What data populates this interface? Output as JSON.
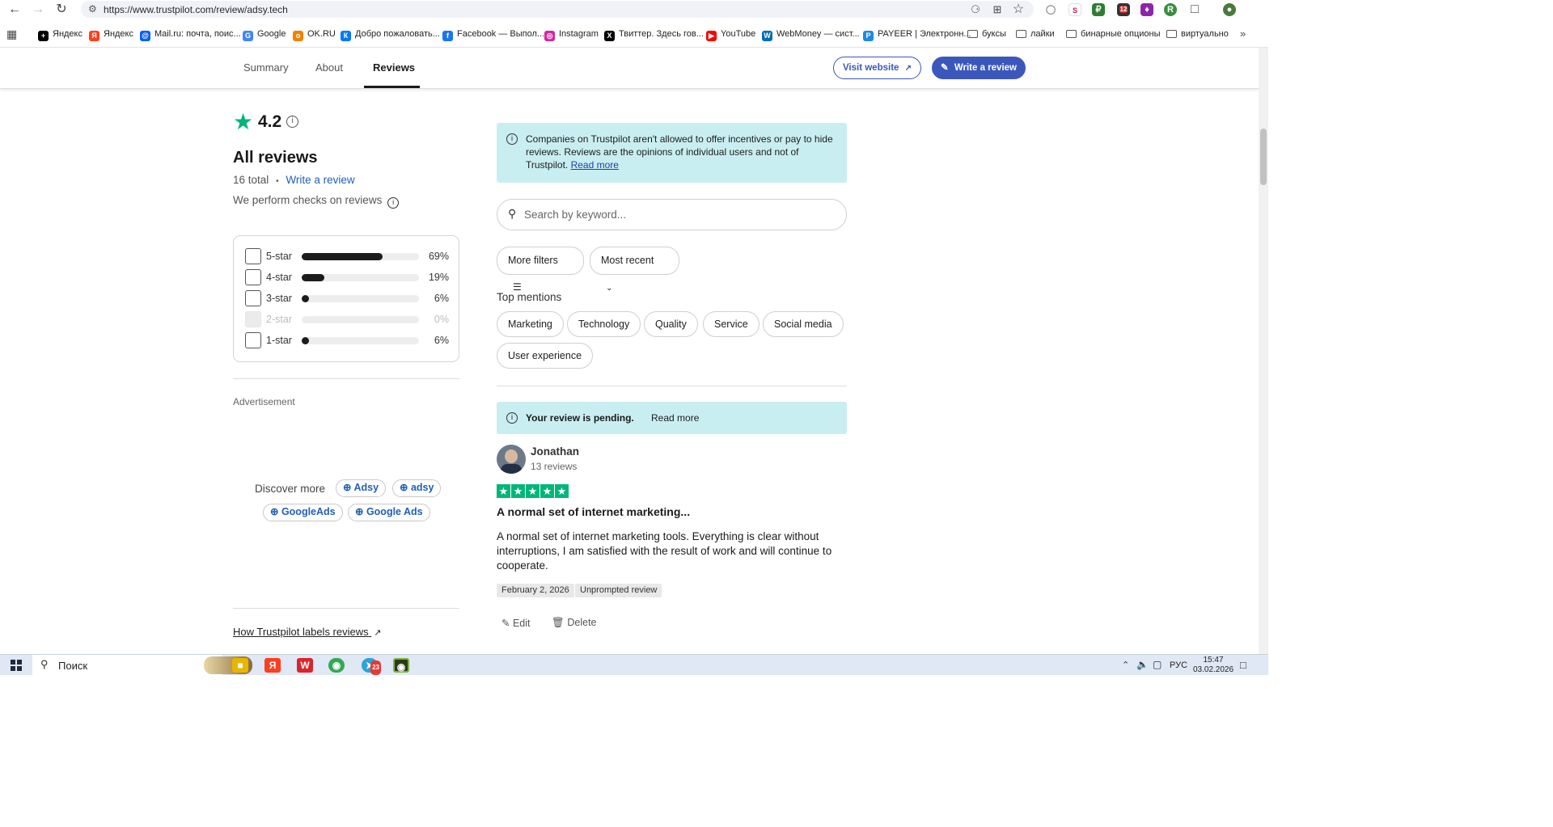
{
  "browser": {
    "url": "https://www.trustpilot.com/review/adsy.tech",
    "bookmarks": [
      {
        "label": "Яндекс",
        "color": "#000000",
        "glyph": "+"
      },
      {
        "label": "Яндекс",
        "color": "#fc3f1d",
        "glyph": "Я"
      },
      {
        "label": "Mail.ru: почта, поис...",
        "color": "#005ff9",
        "glyph": "@"
      },
      {
        "label": "Google",
        "color": "#4285f4",
        "glyph": "G"
      },
      {
        "label": "OK.RU",
        "color": "#ee8208",
        "glyph": "o"
      },
      {
        "label": "Добро пожаловать...",
        "color": "#0077ff",
        "glyph": "К"
      },
      {
        "label": "Facebook — Выпол...",
        "color": "#1877f2",
        "glyph": "f"
      },
      {
        "label": "Instagram",
        "color": "#d6249f",
        "glyph": "◎"
      },
      {
        "label": "Твиттер. Здесь гов...",
        "color": "#000000",
        "glyph": "X"
      },
      {
        "label": "YouTube",
        "color": "#ff0000",
        "glyph": "▶"
      },
      {
        "label": "WebMoney — сист...",
        "color": "#036cb5",
        "glyph": "W"
      },
      {
        "label": "PAYEER | Электронн...",
        "color": "#1e88e5",
        "glyph": "P"
      },
      {
        "label": "буксы",
        "color": "folder",
        "glyph": ""
      },
      {
        "label": "лайки",
        "color": "folder",
        "glyph": ""
      },
      {
        "label": "бинарные опционы",
        "color": "folder",
        "glyph": ""
      },
      {
        "label": "виртуально",
        "color": "folder",
        "glyph": ""
      }
    ],
    "ext_badge": "12"
  },
  "site_nav": {
    "tabs": [
      "Summary",
      "About",
      "Reviews"
    ],
    "active_tab": "Reviews",
    "visit_website": "Visit website",
    "write_review": "Write a review"
  },
  "summary": {
    "rating": "4.2",
    "heading": "All reviews",
    "total": "16 total",
    "separator": "•",
    "write_link": "Write a review",
    "checks": "We perform checks on reviews",
    "distribution": [
      {
        "label": "5-star",
        "percent": 69,
        "percent_label": "69%",
        "enabled": true
      },
      {
        "label": "4-star",
        "percent": 19,
        "percent_label": "19%",
        "enabled": true
      },
      {
        "label": "3-star",
        "percent": 6,
        "percent_label": "6%",
        "enabled": true
      },
      {
        "label": "2-star",
        "percent": 0,
        "percent_label": "0%",
        "enabled": false
      },
      {
        "label": "1-star",
        "percent": 6,
        "percent_label": "6%",
        "enabled": true
      }
    ],
    "advertisement": "Advertisement",
    "discover_more": "Discover more",
    "discover_tags": [
      "Adsy",
      "adsy",
      "GoogleAds",
      "Google Ads"
    ],
    "labels_link": "How Trustpilot labels reviews"
  },
  "notice": {
    "text": "Companies on Trustpilot aren't allowed to offer incentives or pay to hide reviews. Reviews are the opinions of individual users and not of Trustpilot.",
    "read_more": "Read more"
  },
  "search": {
    "placeholder": "Search by keyword..."
  },
  "filters": {
    "more_filters": "More filters",
    "sort": "Most recent"
  },
  "top_mentions": {
    "title": "Top mentions",
    "chips": [
      "Marketing",
      "Technology",
      "Quality",
      "Service",
      "Social media",
      "User experience"
    ]
  },
  "pending": {
    "text": "Your review is pending.",
    "read_more": "Read more"
  },
  "review": {
    "author": "Jonathan",
    "review_count": "13 reviews",
    "stars": 5,
    "title": "A normal set of internet marketing...",
    "body": "A normal set of internet marketing tools. Everything is clear without interruptions, I am satisfied with the result of work and will continue to cooperate.",
    "date": "February 2, 2026",
    "badge": "Unprompted review",
    "edit": "Edit",
    "delete": "Delete"
  },
  "taskbar": {
    "search": "Поиск",
    "lang": "РУС",
    "time": "15:47",
    "date": "03.02.2026",
    "telegram_badge": "23"
  },
  "colors": {
    "brand_blue": "#3c57bc",
    "trust_green": "#00b67a",
    "notice_bg": "#c9eef2"
  }
}
